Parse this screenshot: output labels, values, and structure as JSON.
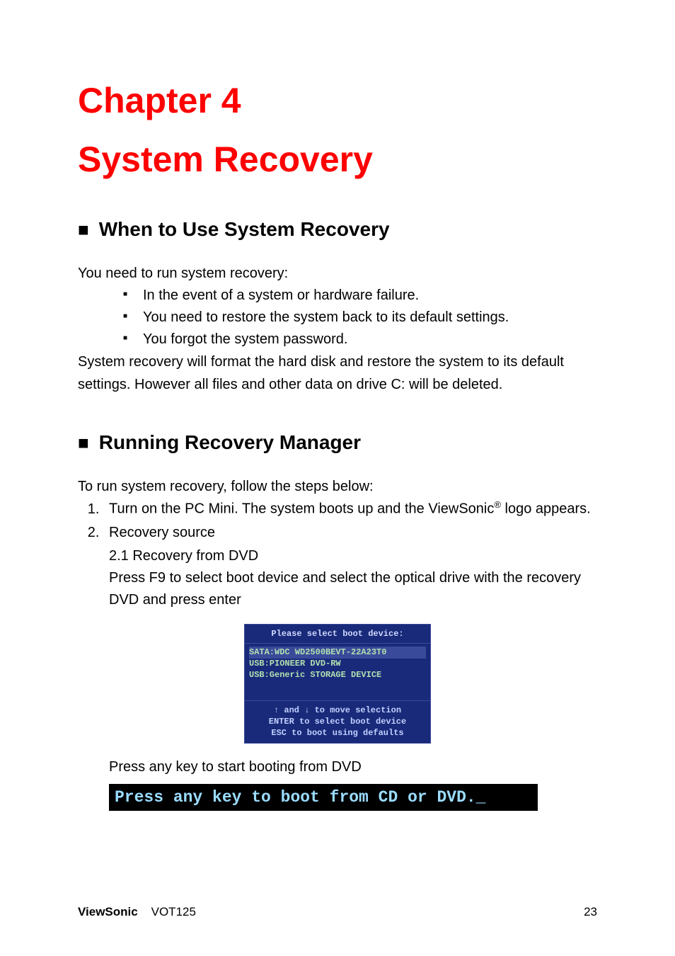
{
  "chapter": {
    "line1": "Chapter 4",
    "line2": "System Recovery"
  },
  "section1": {
    "heading": "When to Use System Recovery",
    "intro": "You need to run system recovery:",
    "bullets": [
      "In the event of a system or hardware failure.",
      "You need to restore the system back to its default settings.",
      "You forgot the system password."
    ],
    "outro": "System recovery will format the hard disk and restore the system to its default settings. However all files and other data on drive C: will be deleted."
  },
  "section2": {
    "heading": "Running Recovery Manager",
    "intro": "To run system recovery, follow the steps below:",
    "step1_pre": "Turn on the PC Mini. The system boots up and the ViewSonic",
    "step1_sup": "®",
    "step1_post": " logo appears.",
    "step2": "Recovery source",
    "sub21": "2.1 Recovery from DVD",
    "sub21_text": "Press F9 to select boot device and select the optical drive with the recovery DVD and press enter",
    "boot_menu": {
      "title": "Please select boot device:",
      "items": [
        "SATA:WDC WD2500BEVT-22A23T0",
        "USB:PIONEER DVD-RW",
        "USB:Generic STORAGE DEVICE"
      ],
      "footer1": "↑ and ↓ to move selection",
      "footer2": "ENTER to select boot device",
      "footer3": "ESC to boot using defaults"
    },
    "press_key_label": "Press any key to start booting from DVD",
    "press_key_img": "Press any key to boot from CD or DVD._"
  },
  "footer": {
    "brand": "ViewSonic",
    "model": "VOT125",
    "page": "23"
  }
}
